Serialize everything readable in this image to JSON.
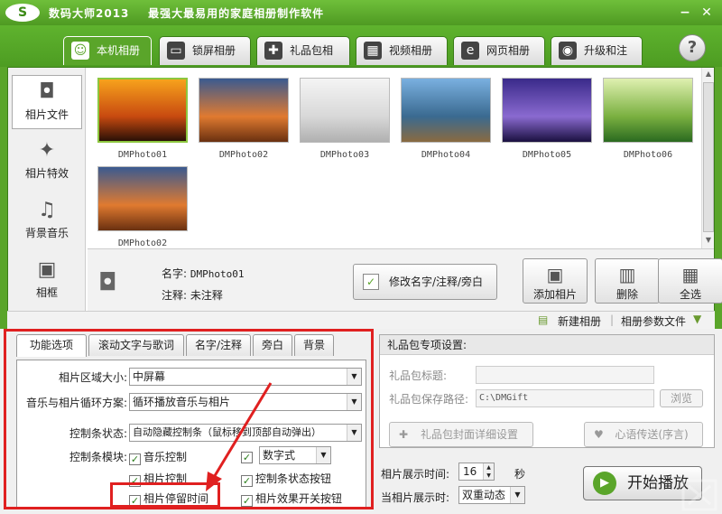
{
  "titlebar": {
    "logo": "S",
    "app_name": "数码大师2013",
    "slogan": "最强大最易用的家庭相册制作软件",
    "minimize": "−",
    "close": "✕"
  },
  "main_tabs": [
    {
      "label": "本机相册",
      "active": true,
      "icon": "person-icon",
      "glyph": "☺"
    },
    {
      "label": "锁屏相册",
      "active": false,
      "icon": "monitor-icon",
      "glyph": "▭"
    },
    {
      "label": "礼品包相册",
      "active": false,
      "icon": "gift-icon",
      "glyph": "✚"
    },
    {
      "label": "视频相册",
      "active": false,
      "icon": "film-icon",
      "glyph": "▦"
    },
    {
      "label": "网页相册",
      "active": false,
      "icon": "ie-icon",
      "glyph": "e"
    },
    {
      "label": "升级和注册",
      "active": false,
      "icon": "globe-icon",
      "glyph": "◉"
    }
  ],
  "help_label": "?",
  "left_nav": [
    {
      "label": "相片文件",
      "icon": "camera-icon",
      "glyph": "◘",
      "active": true
    },
    {
      "label": "相片特效",
      "icon": "effects-icon",
      "glyph": "✦",
      "active": false
    },
    {
      "label": "背景音乐",
      "icon": "music-note-icon",
      "glyph": "♫",
      "active": false
    },
    {
      "label": "相框",
      "icon": "frame-icon",
      "glyph": "▣",
      "active": false
    }
  ],
  "photos": [
    {
      "caption": "DMPhoto01",
      "selected": true,
      "scene": "sunset-couple",
      "colors": [
        "#f7a21c",
        "#c84a10",
        "#2a1006"
      ]
    },
    {
      "caption": "DMPhoto02",
      "selected": false,
      "scene": "sunset-beach",
      "colors": [
        "#3a5a90",
        "#e07a30",
        "#6a3010"
      ]
    },
    {
      "caption": "DMPhoto03",
      "selected": false,
      "scene": "sandals",
      "colors": [
        "#f4f4f4",
        "#d8d8d8",
        "#b0b0b0"
      ]
    },
    {
      "caption": "DMPhoto04",
      "selected": false,
      "scene": "lighthouse",
      "colors": [
        "#7ab0e0",
        "#3a6a90",
        "#8a6a40"
      ]
    },
    {
      "caption": "DMPhoto05",
      "selected": false,
      "scene": "purple-flowers",
      "colors": [
        "#3a2a8a",
        "#8a6ad0",
        "#1a1040"
      ]
    },
    {
      "caption": "DMPhoto06",
      "selected": false,
      "scene": "lily-of-valley",
      "colors": [
        "#dff0b0",
        "#7ab040",
        "#2a6a20"
      ]
    },
    {
      "caption": "DMPhoto02",
      "selected": false,
      "scene": "sunset-beach",
      "colors": [
        "#3a5a90",
        "#e07a30",
        "#6a3010"
      ]
    }
  ],
  "info": {
    "name_label": "名字:",
    "name_value": "DMPhoto01",
    "note_label": "注释:",
    "note_value": "未注释",
    "edit_button": "修改名字/注释/旁白"
  },
  "actions": [
    {
      "label": "添加相片",
      "icon": "add-photo-icon",
      "glyph": "▣"
    },
    {
      "label": "删除",
      "icon": "trash-icon",
      "glyph": "▥"
    },
    {
      "label": "全选",
      "icon": "select-all-icon",
      "glyph": "▦"
    }
  ],
  "toolbar2": {
    "new_album": "新建相册",
    "album_params": "相册参数文件"
  },
  "sub_tabs": [
    {
      "label": "功能选项",
      "active": true
    },
    {
      "label": "滚动文字与歌词",
      "active": false
    },
    {
      "label": "名字/注释",
      "active": false
    },
    {
      "label": "旁白",
      "active": false
    },
    {
      "label": "背景",
      "active": false
    }
  ],
  "options": {
    "photo_area_label": "相片区域大小:",
    "photo_area_value": "中屏幕",
    "loop_label": "音乐与相片循环方案:",
    "loop_value": "循环播放音乐与相片",
    "control_state_label": "控制条状态:",
    "control_state_value": "自动隐藏控制条（鼠标移到顶部自动弹出）",
    "control_module_label": "控制条模块:",
    "music_control": "音乐控制",
    "digit_style": "数字式",
    "photo_control": "相片控制",
    "status_buttons": "控制条状态按钮",
    "photo_dwell": "相片停留时间",
    "effect_switch": "相片效果开关按钮"
  },
  "gift_panel": {
    "header": "礼品包专项设置:",
    "title_label": "礼品包标题:",
    "title_value": "",
    "path_label": "礼品包保存路径:",
    "path_value": "C:\\DMGift",
    "browse": "浏览",
    "cover_button": "礼品包封面详细设置",
    "message_button": "心语传送(序言)"
  },
  "playback": {
    "duration_label": "相片展示时间:",
    "duration_value": "16",
    "duration_unit": "秒",
    "mode_label": "当相片展示时:",
    "mode_value": "双重动态",
    "start_button": "开始播放"
  }
}
